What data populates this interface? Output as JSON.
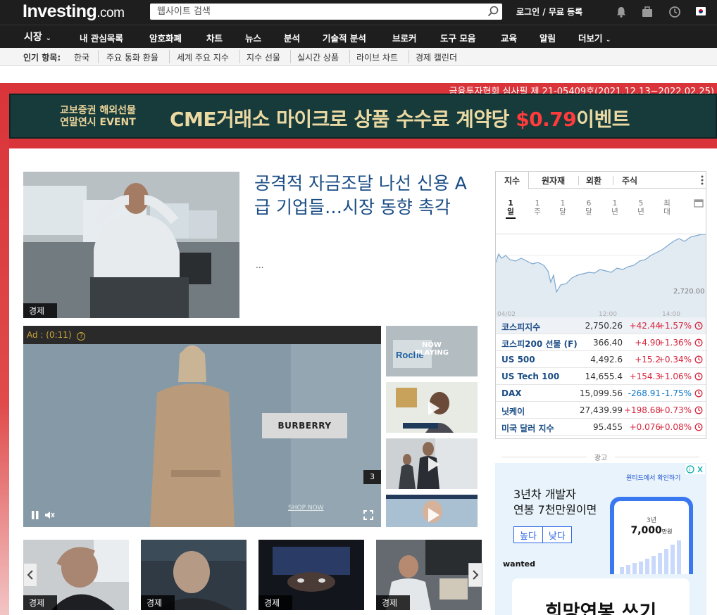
{
  "header": {
    "logo_main": "Investing",
    "logo_suffix": ".com",
    "search_placeholder": "웹사이트 검색",
    "login": "로그인 / 무료 등록"
  },
  "nav": {
    "items": [
      "시장",
      "내 관심목록",
      "암호화폐",
      "차트",
      "뉴스",
      "분석",
      "기술적 분석",
      "브로커",
      "도구 모음",
      "교육",
      "알림",
      "더보기"
    ]
  },
  "popular": {
    "label": "인기 항목:",
    "items": [
      "한국",
      "주요 통화 환율",
      "세계 주요 지수",
      "지수 선물",
      "실시간 상품",
      "라이브 차트",
      "경제 캘린더"
    ]
  },
  "banner": {
    "notice": "금융투자협회 심사필 제 21-05409호(2021.12.13~2022.02.25)",
    "left_line1": "교보증권 해외선물",
    "left_line2": "연말연시 EVENT",
    "main_text": "CME거래소 마이크로 상품 수수료 계약당 ",
    "price": "$0.79",
    "tail": "이벤트"
  },
  "lead": {
    "category": "경제",
    "title": "공격적 자금조달 나선 신용 A급 기업들…시장 동향 촉각",
    "excerpt": "..."
  },
  "video": {
    "ad_label": "Ad : (0:11)",
    "brand": "BURBERRY",
    "shop_now": "SHOP NOW",
    "count": "3",
    "now_playing": "NOW PLAYING"
  },
  "thumbs": [
    {
      "category": "경제"
    },
    {
      "category": "경제"
    },
    {
      "category": "경제"
    },
    {
      "category": "경제"
    }
  ],
  "widget": {
    "tabs": [
      "지수",
      "원자재",
      "외환",
      "주식"
    ],
    "periods": [
      "1일",
      "1주",
      "1달",
      "6달",
      "1년",
      "5년",
      "최대"
    ],
    "chart": {
      "label_value": "2,720.00",
      "x_labels": [
        "04/02",
        "12:00",
        "14:00"
      ]
    },
    "rows": [
      {
        "name": "코스피지수",
        "last": "2,750.26",
        "change": "+42.44",
        "pct": "+1.57%",
        "dir": "up"
      },
      {
        "name": "코스피200 선물 (F)",
        "last": "366.40",
        "change": "+4.90",
        "pct": "+1.36%",
        "dir": "up"
      },
      {
        "name": "US 500",
        "last": "4,492.6",
        "change": "+15.2",
        "pct": "+0.34%",
        "dir": "up"
      },
      {
        "name": "US Tech 100",
        "last": "14,655.4",
        "change": "+154.3",
        "pct": "+1.06%",
        "dir": "up"
      },
      {
        "name": "DAX",
        "last": "15,099.56",
        "change": "-268.91",
        "pct": "-1.75%",
        "dir": "dn"
      },
      {
        "name": "닛케이",
        "last": "27,439.99",
        "change": "+198.68",
        "pct": "+0.73%",
        "dir": "up"
      },
      {
        "name": "미국 달러 지수",
        "last": "95.455",
        "change": "+0.076",
        "pct": "+0.08%",
        "dir": "up"
      }
    ]
  },
  "ad": {
    "label": "광고",
    "tip": "원티드에서 확인하기",
    "headline1": "3년차 개발자",
    "headline2": "연봉 7천만원이면",
    "btn_a": "높다",
    "btn_b": "낮다",
    "brand": "wanted",
    "phone_year": "3년",
    "phone_salary": "7,000",
    "phone_unit": "만원",
    "bottom": "희망연봉 쓰기"
  },
  "colors": {
    "up": "#d7263d",
    "down": "#0b77c4",
    "link": "#1a4c84",
    "banner": "#d9343a"
  }
}
